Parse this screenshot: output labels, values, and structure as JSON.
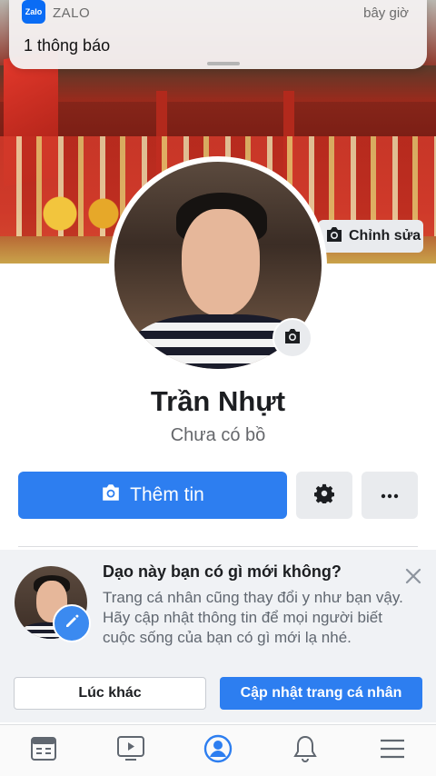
{
  "notification": {
    "app_name": "ZALO",
    "app_icon_text": "Zalo",
    "time": "bây giờ",
    "message": "1 thông báo"
  },
  "cover": {
    "edit_label": "Chỉnh sửa"
  },
  "profile": {
    "name": "Trần Nhựt",
    "relationship": "Chưa có bồ"
  },
  "actions": {
    "add_story_label": "Thêm tin"
  },
  "suggestion_card": {
    "title": "Dạo này bạn có gì mới không?",
    "body": "Trang cá nhân cũng thay đổi y như bạn vậy. Hãy cập nhật thông tin để mọi người biết cuộc sống của bạn có gì mới lạ nhé.",
    "later_label": "Lúc khác",
    "update_label": "Cập nhật trang cá nhân"
  },
  "bottom_nav": {
    "items": [
      {
        "icon": "news-feed-icon",
        "active": false
      },
      {
        "icon": "watch-video-icon",
        "active": false
      },
      {
        "icon": "profile-icon",
        "active": true
      },
      {
        "icon": "notifications-bell-icon",
        "active": false
      },
      {
        "icon": "menu-icon",
        "active": false
      }
    ]
  },
  "colors": {
    "accent": "#2d7ef0",
    "secondary_button": "#e9ebee",
    "muted_text": "#65676b",
    "card_background": "#f0f2f5"
  }
}
